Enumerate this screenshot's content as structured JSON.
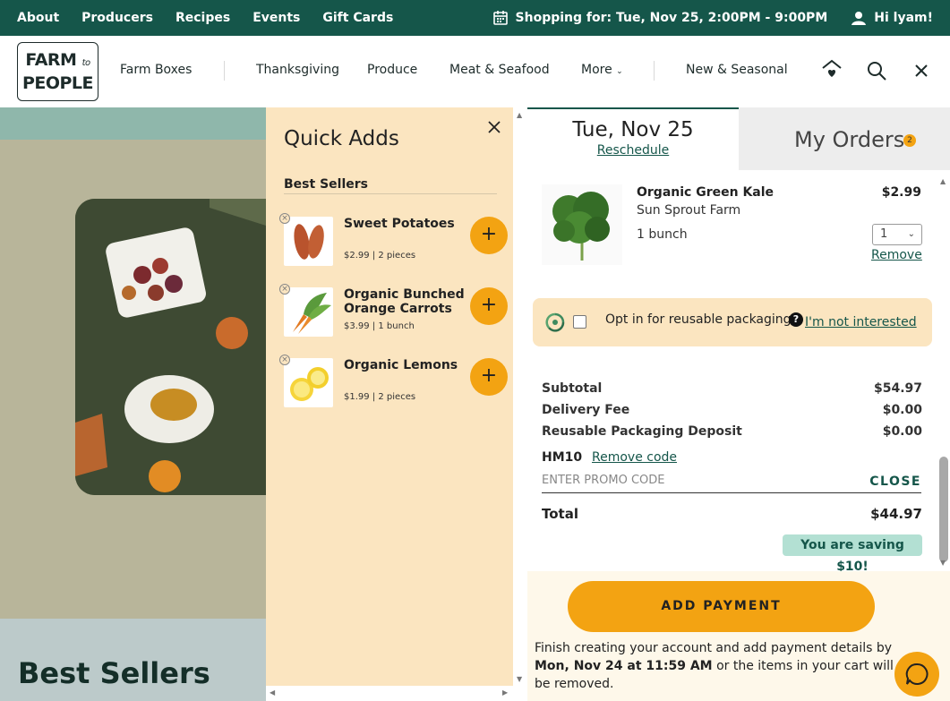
{
  "topbar": {
    "links": [
      "About",
      "Producers",
      "Recipes",
      "Events",
      "Gift Cards"
    ],
    "shopping_for": "Shopping for: Tue, Nov 25, 2:00PM - 9:00PM",
    "greeting": "Hi lyam!"
  },
  "nav": {
    "logo_line1": "FARM",
    "logo_line2": "to",
    "logo_line3": "PEOPLE",
    "items": [
      "Farm Boxes",
      "Thanksgiving",
      "Produce",
      "Meat & Seafood",
      "More",
      "New & Seasonal"
    ]
  },
  "background": {
    "heading": "Best Sellers"
  },
  "quick_adds": {
    "title": "Quick Adds",
    "section": "Best Sellers",
    "items": [
      {
        "name": "Sweet Potatoes",
        "price": "$2.99",
        "qty": "2 pieces"
      },
      {
        "name": "Organic Bunched Orange Carrots",
        "price": "$3.99",
        "qty": "1 bunch"
      },
      {
        "name": "Organic Lemons",
        "price": "$1.99",
        "qty": "2 pieces"
      }
    ]
  },
  "cart": {
    "date_tab": "Tue, Nov 25",
    "reschedule": "Reschedule",
    "orders_tab": "My Orders",
    "orders_count": "2",
    "product": {
      "name": "Organic Green Kale",
      "farm": "Sun Sprout Farm",
      "unit": "1 bunch",
      "price": "$2.99",
      "qty": "1",
      "remove": "Remove"
    },
    "optin": {
      "text": "Opt in for reusable packaging.",
      "help": "?",
      "decline": "I'm not interested"
    },
    "summary": [
      {
        "label": "Subtotal",
        "value": "$54.97"
      },
      {
        "label": "Delivery Fee",
        "value": "$0.00"
      },
      {
        "label": "Reusable Packaging Deposit",
        "value": "$0.00"
      }
    ],
    "promo_code": "HM10",
    "remove_code": "Remove code",
    "promo_placeholder": "ENTER PROMO CODE",
    "promo_close": "CLOSE",
    "total_label": "Total",
    "total_value": "$44.97",
    "saving": "You are saving $10!",
    "pay_button": "ADD PAYMENT",
    "pay_msg_1": "Finish creating your account and add payment details by ",
    "pay_msg_date": "Mon, Nov 24 at 11:59 AM",
    "pay_msg_2": " or the items in your cart will be removed."
  },
  "colors": {
    "brand_green": "#15564a",
    "accent_orange": "#f3a312",
    "cream": "#fbe5c0"
  }
}
